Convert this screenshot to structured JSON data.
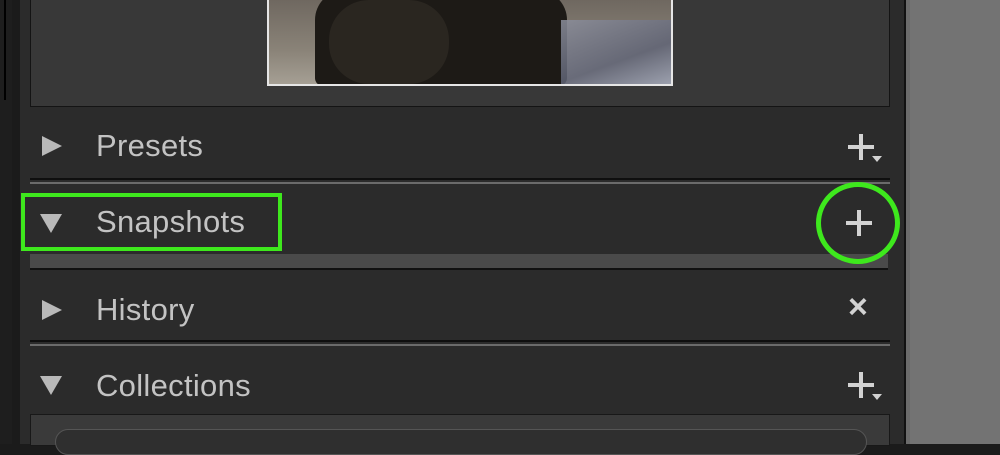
{
  "panels": {
    "presets": {
      "title": "Presets",
      "expanded": false,
      "action_icon": "plus-dropdown-icon"
    },
    "snapshots": {
      "title": "Snapshots",
      "expanded": true,
      "action_icon": "plus-icon"
    },
    "history": {
      "title": "History",
      "expanded": false,
      "action_icon": "close-icon"
    },
    "collections": {
      "title": "Collections",
      "expanded": true,
      "action_icon": "plus-dropdown-icon"
    }
  },
  "history_clear_symbol": "×",
  "colors": {
    "panel_bg": "#2b2b2b",
    "header_text": "#c3c3c3",
    "highlight": "#3ee81d"
  }
}
